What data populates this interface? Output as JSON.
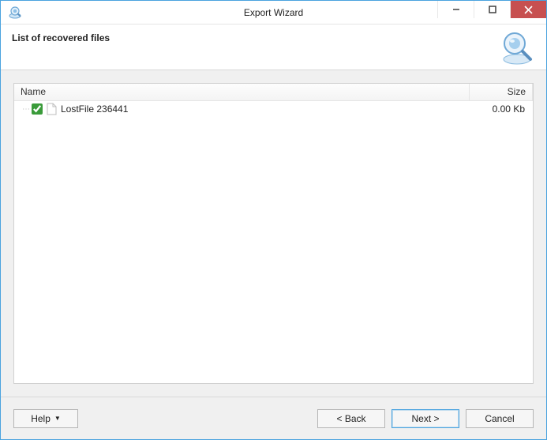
{
  "window": {
    "title": "Export Wizard"
  },
  "header": {
    "title": "List of recovered files"
  },
  "list": {
    "columns": {
      "name": "Name",
      "size": "Size"
    },
    "rows": [
      {
        "checked": true,
        "name": "LostFile 236441",
        "size": "0.00 Kb"
      }
    ]
  },
  "footer": {
    "help": "Help",
    "back": "< Back",
    "next": "Next >",
    "cancel": "Cancel"
  }
}
